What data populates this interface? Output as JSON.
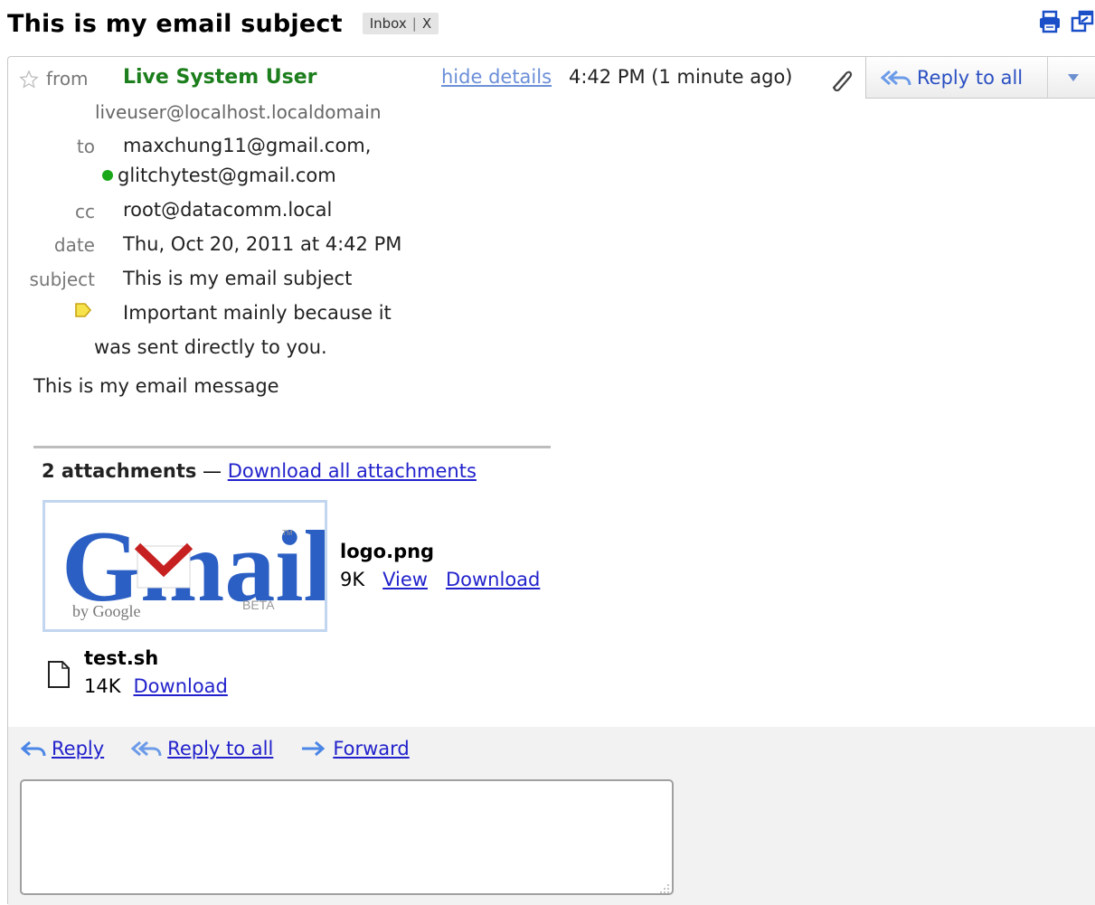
{
  "header": {
    "subject": "This is my email subject",
    "label": "Inbox",
    "label_remove": "X",
    "print_icon": "print-icon",
    "newwindow_icon": "new-window-icon"
  },
  "message": {
    "from_label": "from",
    "sender_name": "Live System User",
    "sender_email": "liveuser@localhost.localdomain",
    "hide_details": "hide details",
    "time": "4:42 PM (1 minute ago)",
    "reply_all_button": "Reply to all",
    "to_label": "to",
    "to_1": "maxchung11@gmail.com,",
    "to_2": "glitchytest@gmail.com",
    "cc_label": "cc",
    "cc": "root@datacomm.local",
    "date_label": "date",
    "date": "Thu, Oct 20, 2011 at 4:42 PM",
    "subject_label": "subject",
    "subject": "This is my email subject",
    "important_1": "Important mainly because it",
    "important_2": "was sent directly to you.",
    "body": "This is my email message"
  },
  "attachments": {
    "count_label": "2 attachments",
    "dash": " — ",
    "download_all": "Download all attachments",
    "items": [
      {
        "name": "logo.png",
        "size": "9K",
        "view": "View",
        "download": "Download"
      },
      {
        "name": "test.sh",
        "size": "14K",
        "download": "Download"
      }
    ],
    "thumb": {
      "logo": "Gmail",
      "by": "by Google",
      "beta": "BETA",
      "tm": "TM"
    }
  },
  "footer": {
    "reply": "Reply",
    "reply_all": "Reply to all",
    "forward": "Forward",
    "reply_box_value": ""
  },
  "colors": {
    "sender": "#1d7e1d",
    "link": "#2222cc",
    "online": "#1aa81a"
  }
}
